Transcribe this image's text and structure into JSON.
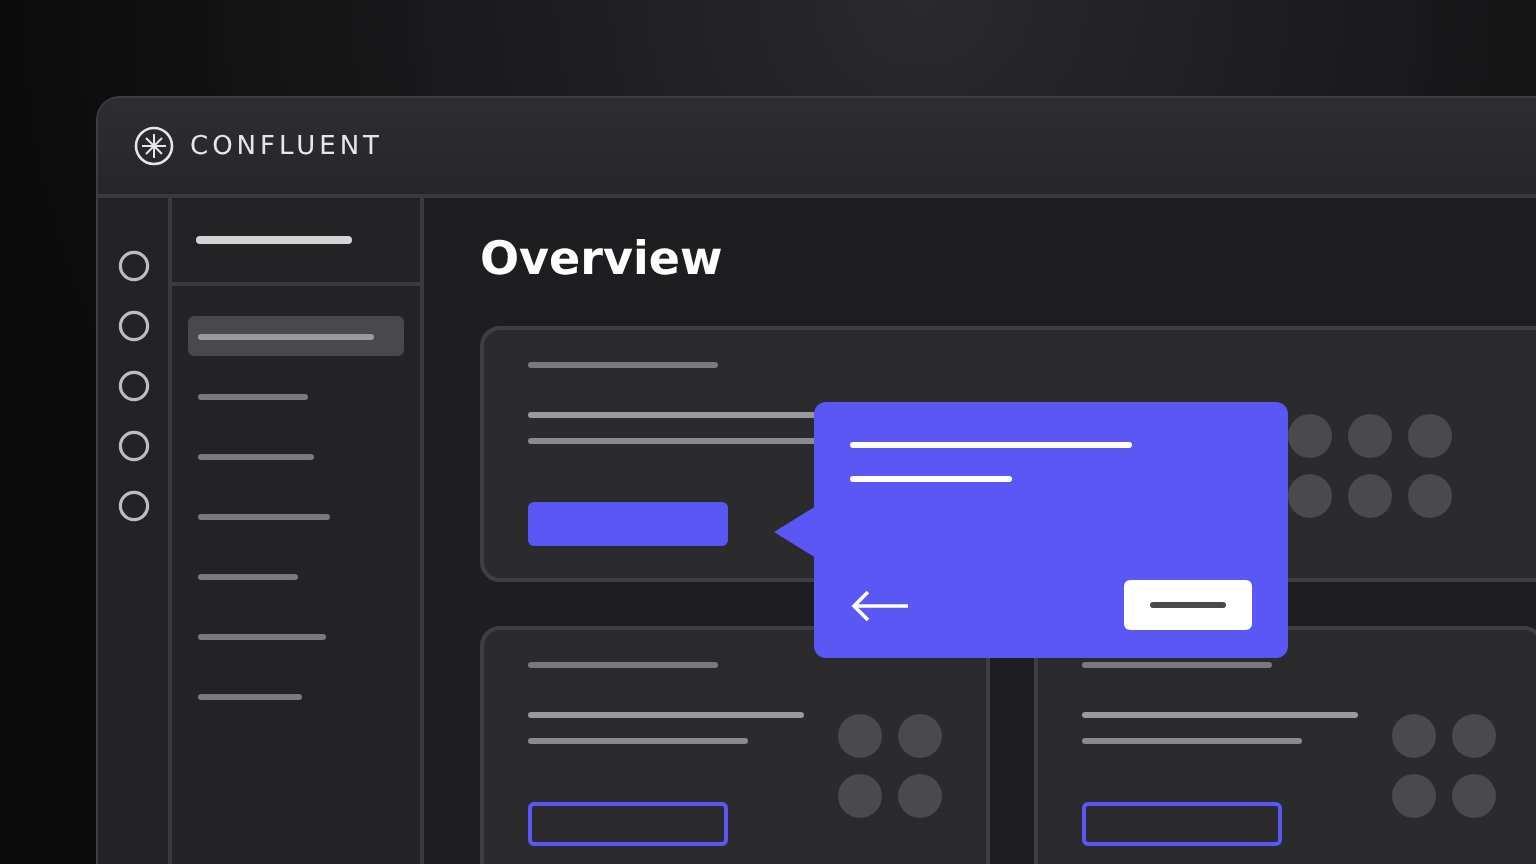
{
  "app": {
    "name": "CONFLUENT"
  },
  "page": {
    "title": "Overview"
  },
  "nav_items": [
    {
      "selected": true
    },
    {
      "selected": false
    },
    {
      "selected": false
    },
    {
      "selected": false
    },
    {
      "selected": false
    },
    {
      "selected": false
    },
    {
      "selected": false
    }
  ],
  "cards": [
    {
      "kind": "primary"
    },
    {
      "kind": "outline"
    },
    {
      "kind": "outline"
    }
  ]
}
